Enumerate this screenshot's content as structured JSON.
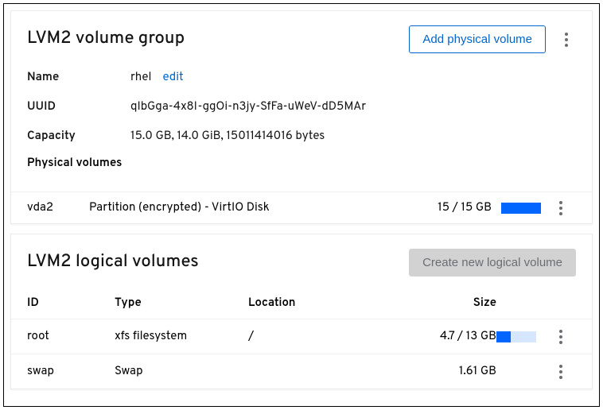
{
  "vg": {
    "title": "LVM2 volume group",
    "add_btn": "Add physical volume",
    "props": {
      "name_label": "Name",
      "name_value": "rhel",
      "edit_link": "edit",
      "uuid_label": "UUID",
      "uuid_value": "qIbGga-4x8I-ggOi-n3jy-SfFa-uWeV-dD5MAr",
      "capacity_label": "Capacity",
      "capacity_value": "15.0 GB, 14.0 GiB, 15011414016 bytes"
    },
    "pv_section_label": "Physical volumes",
    "pv": {
      "name": "vda2",
      "desc": "Partition (encrypted) - VirtIO Disk",
      "size": "15 / 15 GB"
    }
  },
  "lv": {
    "title": "LVM2 logical volumes",
    "create_btn": "Create new logical volume",
    "headers": {
      "id": "ID",
      "type": "Type",
      "location": "Location",
      "size": "Size"
    },
    "rows": [
      {
        "id": "root",
        "type": "xfs filesystem",
        "location": "/",
        "size": "4.7 / 13 GB",
        "fill_pct": 36
      },
      {
        "id": "swap",
        "type": "Swap",
        "location": "",
        "size": "1.61 GB",
        "fill_pct": null
      }
    ]
  }
}
